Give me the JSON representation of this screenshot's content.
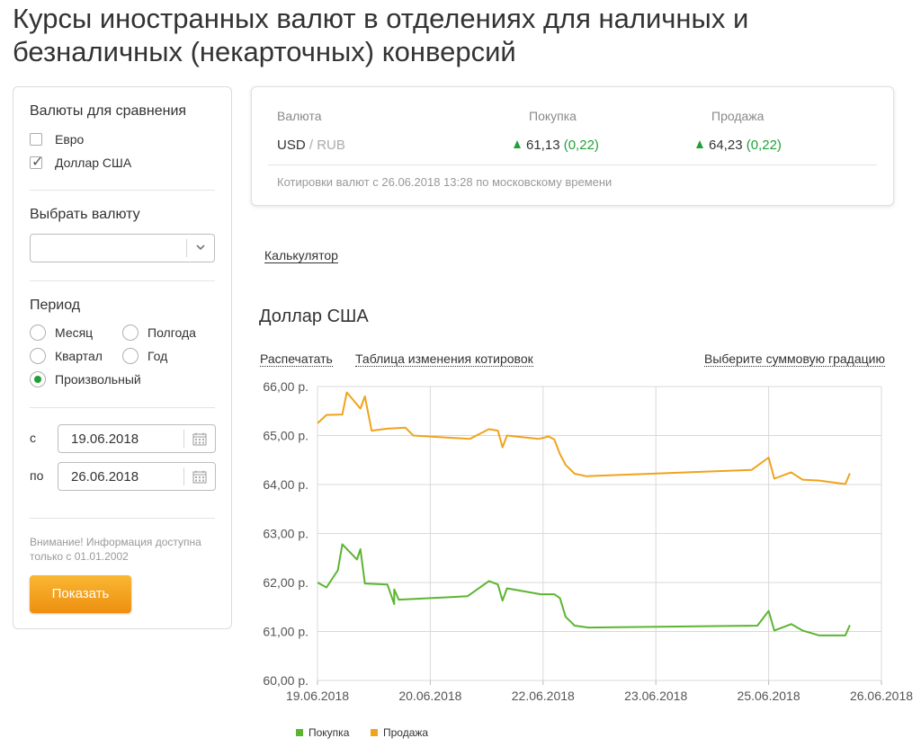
{
  "page": {
    "title": "Курсы иностранных валют в отделениях для наличных и безналичных (некарточных) конверсий"
  },
  "filter": {
    "compare_title": "Валюты для сравнения",
    "compare_options": [
      {
        "label": "Евро",
        "checked": false
      },
      {
        "label": "Доллар США",
        "checked": true
      }
    ],
    "select_currency_title": "Выбрать валюту",
    "select_currency_value": "",
    "period_title": "Период",
    "period_options": [
      {
        "label": "Месяц",
        "selected": false
      },
      {
        "label": "Полгода",
        "selected": false
      },
      {
        "label": "Квартал",
        "selected": false
      },
      {
        "label": "Год",
        "selected": false
      },
      {
        "label": "Произвольный",
        "selected": true
      }
    ],
    "from_label": "с",
    "from_value": "19.06.2018",
    "to_label": "по",
    "to_value": "26.06.2018",
    "notice": "Внимание! Информация доступна только с 01.01.2002",
    "show_button": "Показать"
  },
  "rates": {
    "col_currency": "Валюта",
    "col_buy": "Покупка",
    "col_sell": "Продажа",
    "pair_base": "USD",
    "pair_sep": " / ",
    "pair_quote": "RUB",
    "buy_value": "61,13",
    "buy_delta": "(0,22)",
    "sell_value": "64,23",
    "sell_delta": "(0,22)",
    "note": "Котировки валют с 26.06.2018 13:28 по московскому времени"
  },
  "links": {
    "calculator": "Калькулятор",
    "print": "Распечатать",
    "changes_table": "Таблица изменения котировок",
    "amount_gradation": "Выберите суммовую градацию"
  },
  "chart_heading": "Доллар США",
  "colors": {
    "buy": "#5cb531",
    "sell": "#f0a31c",
    "accent_green": "#21a038",
    "button_orange": "#f4a224"
  },
  "chart_data": {
    "type": "line",
    "x_ticks": [
      "19.06.2018",
      "20.06.2018",
      "22.06.2018",
      "23.06.2018",
      "25.06.2018",
      "26.06.2018"
    ],
    "y_ticks": [
      "60,00 р.",
      "61,00 р.",
      "62,00 р.",
      "63,00 р.",
      "64,00 р.",
      "65,00 р.",
      "66,00 р."
    ],
    "ylim": [
      60,
      66
    ],
    "grid": true,
    "legend": "bottom",
    "series": [
      {
        "name": "Покупка",
        "color": "#5cb531",
        "points": [
          [
            0.0,
            62.0
          ],
          [
            0.08,
            61.9
          ],
          [
            0.18,
            62.25
          ],
          [
            0.22,
            62.78
          ],
          [
            0.35,
            62.47
          ],
          [
            0.38,
            62.68
          ],
          [
            0.42,
            61.98
          ],
          [
            0.62,
            61.96
          ],
          [
            0.68,
            61.56
          ],
          [
            0.68,
            61.86
          ],
          [
            0.72,
            61.65
          ],
          [
            1.33,
            61.72
          ],
          [
            1.52,
            62.03
          ],
          [
            1.6,
            61.96
          ],
          [
            1.64,
            61.63
          ],
          [
            1.68,
            61.88
          ],
          [
            1.98,
            61.76
          ],
          [
            2.1,
            61.76
          ],
          [
            2.15,
            61.68
          ],
          [
            2.2,
            61.3
          ],
          [
            2.28,
            61.12
          ],
          [
            2.4,
            61.08
          ],
          [
            3.9,
            61.12
          ],
          [
            4.0,
            61.42
          ],
          [
            4.05,
            61.02
          ],
          [
            4.2,
            61.15
          ],
          [
            4.3,
            61.02
          ],
          [
            4.45,
            60.92
          ],
          [
            4.68,
            60.92
          ],
          [
            4.72,
            61.13
          ]
        ]
      },
      {
        "name": "Продажа",
        "color": "#f0a31c",
        "points": [
          [
            0.0,
            65.25
          ],
          [
            0.08,
            65.42
          ],
          [
            0.22,
            65.43
          ],
          [
            0.26,
            65.88
          ],
          [
            0.38,
            65.55
          ],
          [
            0.42,
            65.8
          ],
          [
            0.48,
            65.1
          ],
          [
            0.62,
            65.14
          ],
          [
            0.78,
            65.16
          ],
          [
            0.85,
            65.0
          ],
          [
            1.35,
            64.93
          ],
          [
            1.52,
            65.13
          ],
          [
            1.6,
            65.1
          ],
          [
            1.64,
            64.76
          ],
          [
            1.68,
            65.0
          ],
          [
            1.96,
            64.93
          ],
          [
            2.05,
            64.98
          ],
          [
            2.1,
            64.92
          ],
          [
            2.15,
            64.62
          ],
          [
            2.2,
            64.4
          ],
          [
            2.28,
            64.22
          ],
          [
            2.38,
            64.17
          ],
          [
            3.85,
            64.3
          ],
          [
            4.0,
            64.55
          ],
          [
            4.05,
            64.12
          ],
          [
            4.2,
            64.25
          ],
          [
            4.3,
            64.1
          ],
          [
            4.45,
            64.08
          ],
          [
            4.68,
            64.01
          ],
          [
            4.72,
            64.23
          ]
        ]
      }
    ]
  }
}
